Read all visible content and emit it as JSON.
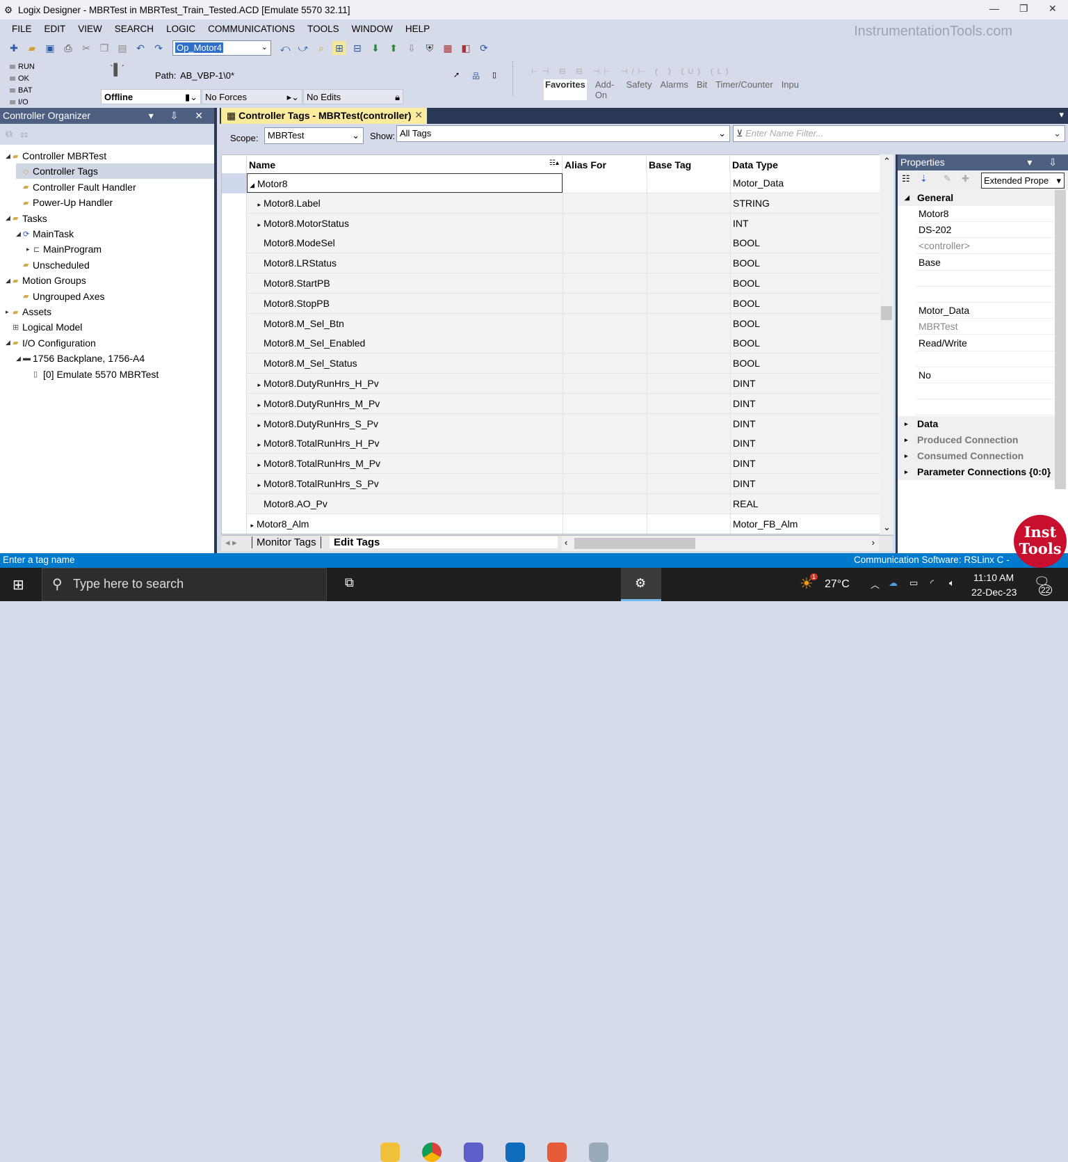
{
  "window": {
    "title": "Logix Designer - MBRTest in MBRTest_Train_Tested.ACD [Emulate 5570 32.11]"
  },
  "menu": [
    "FILE",
    "EDIT",
    "VIEW",
    "SEARCH",
    "LOGIC",
    "COMMUNICATIONS",
    "TOOLS",
    "WINDOW",
    "HELP"
  ],
  "watermark": "InstrumentationTools.com",
  "toolbar": {
    "routine_value": "Op_Motor4"
  },
  "status": {
    "leds": [
      "RUN",
      "OK",
      "BAT",
      "I/O"
    ],
    "path_label": "Path:",
    "path": "AB_VBP-1\\0*",
    "mode": "Offline",
    "forces": "No Forces",
    "edits": "No Edits"
  },
  "instruction_tabs": [
    "Favorites",
    "Add-On",
    "Safety",
    "Alarms",
    "Bit",
    "Timer/Counter",
    "Inpu"
  ],
  "organizer": {
    "title": "Controller Organizer",
    "items": [
      {
        "label": "Controller MBRTest",
        "level": 0,
        "toggle": "◢",
        "icon": "folder"
      },
      {
        "label": "Controller Tags",
        "level": 1,
        "toggle": "",
        "icon": "tag",
        "selected": true
      },
      {
        "label": "Controller Fault Handler",
        "level": 1,
        "toggle": "",
        "icon": "folder"
      },
      {
        "label": "Power-Up Handler",
        "level": 1,
        "toggle": "",
        "icon": "folder"
      },
      {
        "label": "Tasks",
        "level": 0,
        "toggle": "◢",
        "icon": "folder"
      },
      {
        "label": "MainTask",
        "level": 1,
        "toggle": "◢",
        "icon": "task"
      },
      {
        "label": "MainProgram",
        "level": 2,
        "toggle": "▸",
        "icon": "program"
      },
      {
        "label": "Unscheduled",
        "level": 1,
        "toggle": "",
        "icon": "folder"
      },
      {
        "label": "Motion Groups",
        "level": 0,
        "toggle": "◢",
        "icon": "folder"
      },
      {
        "label": "Ungrouped Axes",
        "level": 1,
        "toggle": "",
        "icon": "folder"
      },
      {
        "label": "Assets",
        "level": 0,
        "toggle": "▸",
        "icon": "folder"
      },
      {
        "label": "Logical Model",
        "level": 0,
        "toggle": "",
        "icon": "model"
      },
      {
        "label": "I/O Configuration",
        "level": 0,
        "toggle": "◢",
        "icon": "folder"
      },
      {
        "label": "1756 Backplane, 1756-A4",
        "level": 1,
        "toggle": "◢",
        "icon": "backplane"
      },
      {
        "label": "[0] Emulate 5570 MBRTest",
        "level": 2,
        "toggle": "",
        "icon": "module"
      }
    ]
  },
  "doc_tab": {
    "title": "Controller Tags - MBRTest(controller)"
  },
  "scope": {
    "label": "Scope:",
    "value": "MBRTest",
    "show_label": "Show:",
    "show_value": "All Tags",
    "filter_placeholder": "Enter Name Filter..."
  },
  "grid": {
    "columns": [
      "Name",
      "Alias For",
      "Base Tag",
      "Data Type"
    ],
    "rows": [
      {
        "name": "Motor8",
        "type": "Motor_Data",
        "expander": "◢",
        "child": false,
        "selected": true
      },
      {
        "name": "Motor8.Label",
        "type": "STRING",
        "expander": "▸",
        "child": true
      },
      {
        "name": "Motor8.MotorStatus",
        "type": "INT",
        "expander": "▸",
        "child": true
      },
      {
        "name": "Motor8.ModeSel",
        "type": "BOOL",
        "expander": "",
        "child": true
      },
      {
        "name": "Motor8.LRStatus",
        "type": "BOOL",
        "expander": "",
        "child": true
      },
      {
        "name": "Motor8.StartPB",
        "type": "BOOL",
        "expander": "",
        "child": true
      },
      {
        "name": "Motor8.StopPB",
        "type": "BOOL",
        "expander": "",
        "child": true
      },
      {
        "name": "Motor8.M_Sel_Btn",
        "type": "BOOL",
        "expander": "",
        "child": true
      },
      {
        "name": "Motor8.M_Sel_Enabled",
        "type": "BOOL",
        "expander": "",
        "child": true
      },
      {
        "name": "Motor8.M_Sel_Status",
        "type": "BOOL",
        "expander": "",
        "child": true
      },
      {
        "name": "Motor8.DutyRunHrs_H_Pv",
        "type": "DINT",
        "expander": "▸",
        "child": true
      },
      {
        "name": "Motor8.DutyRunHrs_M_Pv",
        "type": "DINT",
        "expander": "▸",
        "child": true
      },
      {
        "name": "Motor8.DutyRunHrs_S_Pv",
        "type": "DINT",
        "expander": "▸",
        "child": true
      },
      {
        "name": "Motor8.TotalRunHrs_H_Pv",
        "type": "DINT",
        "expander": "▸",
        "child": true
      },
      {
        "name": "Motor8.TotalRunHrs_M_Pv",
        "type": "DINT",
        "expander": "▸",
        "child": true
      },
      {
        "name": "Motor8.TotalRunHrs_S_Pv",
        "type": "DINT",
        "expander": "▸",
        "child": true
      },
      {
        "name": "Motor8.AO_Pv",
        "type": "REAL",
        "expander": "",
        "child": true
      },
      {
        "name": "Motor8_Alm",
        "type": "Motor_FB_Alm",
        "expander": "▸",
        "child": false
      }
    ],
    "bottom_tabs": [
      "Monitor Tags",
      "Edit Tags"
    ]
  },
  "properties": {
    "title": "Properties",
    "view": "Extended Prope",
    "general": "General",
    "values": [
      "Motor8",
      "DS-202",
      "<controller>",
      "Base",
      "",
      "",
      "Motor_Data",
      "MBRTest",
      "Read/Write",
      "",
      "No",
      "",
      ""
    ],
    "categories": [
      "Data",
      "Produced Connection",
      "Consumed Connection",
      "Parameter Connections {0:0}"
    ]
  },
  "statusbar": {
    "left": "Enter a tag name",
    "right": "Communication Software: RSLinx C -"
  },
  "logo": {
    "line1": "Inst",
    "line2": "Tools"
  },
  "taskbar": {
    "search": "Type here to search",
    "weather": "27°C",
    "weather_badge": "1",
    "time": "11:10 AM",
    "date": "22-Dec-23",
    "notifications": "22"
  }
}
